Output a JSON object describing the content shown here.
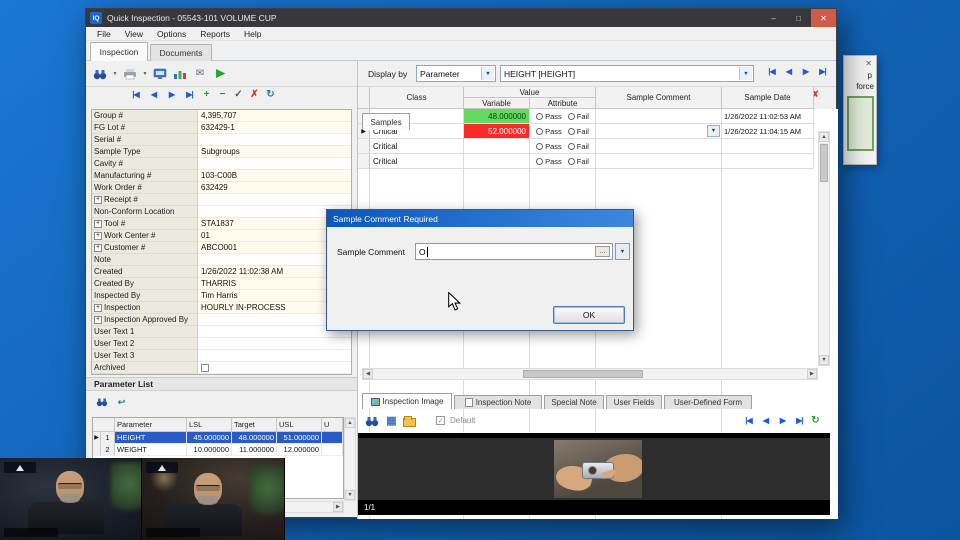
{
  "icons": {
    "minimize": "–",
    "maximize": "□",
    "close": "✕",
    "first": "|◀",
    "prev": "◀",
    "next": "▶",
    "last": "▶|",
    "add": "+",
    "remove": "−",
    "check": "✓",
    "cross": "✗",
    "refresh": "↻",
    "up": "▲",
    "down": "▼",
    "left": "◀",
    "right": "▶",
    "dropdown": "▼",
    "ellipsis": "…",
    "undo": "↩",
    "pencil": "✎",
    "table": "▦",
    "calculator": "▥",
    "mail": "✉"
  },
  "window": {
    "icon_text": "IQ",
    "title": "Quick Inspection - 05543-101 VOLUME CUP",
    "menu": [
      "File",
      "View",
      "Options",
      "Reports",
      "Help"
    ],
    "tabs": [
      "Inspection",
      "Documents"
    ]
  },
  "display_bar": {
    "label": "Display by",
    "mode": "Parameter",
    "parameter": "HEIGHT [HEIGHT]"
  },
  "properties": [
    {
      "label": "Group #",
      "value": "4,395,707"
    },
    {
      "label": "FG Lot #",
      "value": "632429-1"
    },
    {
      "label": "Serial #",
      "value": ""
    },
    {
      "label": "Sample Type",
      "value": "Subgroups"
    },
    {
      "label": "Cavity #",
      "value": ""
    },
    {
      "label": "Manufacturing #",
      "value": "103-C00B"
    },
    {
      "label": "Work Order #",
      "value": "632429"
    },
    {
      "label": "Receipt #",
      "value": "",
      "expand": true
    },
    {
      "label": "Non-Conform Location",
      "value": ""
    },
    {
      "label": "Tool #",
      "value": "STA1837",
      "expand": true
    },
    {
      "label": "Work Center #",
      "value": "01",
      "expand": true
    },
    {
      "label": "Customer #",
      "value": "ABCO001",
      "expand": true
    },
    {
      "label": "Note",
      "value": ""
    },
    {
      "label": "Created",
      "value": "1/26/2022 11:02:38 AM"
    },
    {
      "label": "Created By",
      "value": "THARRIS"
    },
    {
      "label": "Inspected By",
      "value": "Tim Harris"
    },
    {
      "label": "Inspection",
      "value": "HOURLY IN-PROCESS",
      "expand": true
    },
    {
      "label": "Inspection Approved By",
      "value": "",
      "expand": true
    },
    {
      "label": "User Text 1",
      "value": ""
    },
    {
      "label": "User Text 2",
      "value": ""
    },
    {
      "label": "User Text 3",
      "value": ""
    },
    {
      "label": "Archived",
      "value": "",
      "checkbox": true
    }
  ],
  "samples_panel": {
    "tabs": [
      "Samples",
      "Documents"
    ],
    "headers": {
      "class_col": "Class",
      "value": "Value",
      "variable": "Variable",
      "attribute": "Attribute",
      "comment": "Sample Comment",
      "date": "Sample Date",
      "pass": "Pass",
      "fail": "Fail"
    },
    "rows": [
      {
        "class_name": "Critical",
        "variable": "48.000000",
        "state": "pass",
        "date": "1/26/2022 11:02:53 AM"
      },
      {
        "class_name": "Critical",
        "variable": "52.000000",
        "state": "fail",
        "date": "1/26/2022 11:04:15 AM",
        "selected": true,
        "comment_editor": true
      },
      {
        "class_name": "Critical",
        "variable": "",
        "state": "",
        "date": ""
      },
      {
        "class_name": "Critical",
        "variable": "",
        "state": "",
        "date": ""
      }
    ]
  },
  "dialog": {
    "title": "Sample Comment Required",
    "field_label": "Sample Comment",
    "value": "O",
    "ok": "OK"
  },
  "parameter_list": {
    "title": "Parameter List",
    "columns": [
      "Parameter",
      "LSL",
      "Target",
      "USL",
      "U"
    ],
    "rows": [
      {
        "num": "1",
        "parameter": "HEIGHT",
        "lsl": "45.000000",
        "target": "48.000000",
        "usl": "51.000000",
        "selected": true
      },
      {
        "num": "2",
        "parameter": "WEIGHT",
        "lsl": "10.000000",
        "target": "11.000000",
        "usl": "12.000000"
      }
    ]
  },
  "bottom_panel": {
    "tabs": [
      "Inspection Image",
      "Inspection Note",
      "Special Note",
      "User Fields",
      "User-Defined Form"
    ],
    "default_label": "Default",
    "counter": "1/1"
  },
  "side_window": {
    "text_top": "p",
    "text_bottom": "force"
  },
  "colors": {
    "pass_green": "#63d963",
    "fail_red": "#fb2a2a",
    "selection_blue": "#2a5ac6",
    "desktop_blue": "#1468c0",
    "dialog_title": "#0c56bd"
  }
}
